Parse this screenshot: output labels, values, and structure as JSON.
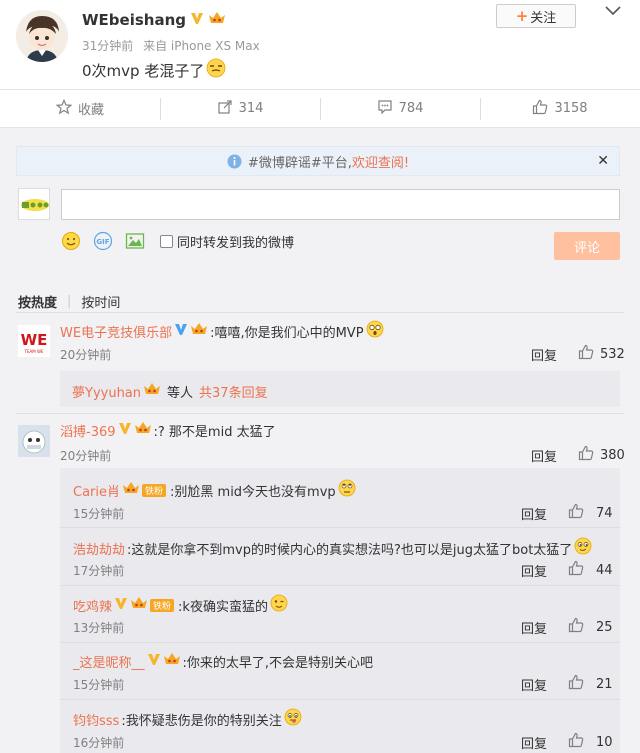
{
  "post": {
    "username": "WEbeishang",
    "time": "31分钟前",
    "source": "来自 iPhone XS Max",
    "text": "0次mvp 老混子了",
    "follow_label": "关注"
  },
  "actions": {
    "favorite": "收藏",
    "repost": "314",
    "comment": "784",
    "like": "3158"
  },
  "notice": {
    "prefix": "#微博辟谣#平台,",
    "link": "欢迎查阅!"
  },
  "composer": {
    "input_value": "",
    "repost_label": "同时转发到我的微博",
    "submit_label": "评论"
  },
  "sort": {
    "hot": "按热度",
    "time": "按时间"
  },
  "comments": [
    {
      "name": "WE电子竞技俱乐部",
      "text": ":嘻嘻,你是我们心中的MVP",
      "time": "20分钟前",
      "reply": "回复",
      "likes": "532",
      "summary": {
        "user": "夢Yyyuhan",
        "middle": "等人",
        "link": "共37条回复"
      }
    },
    {
      "name": "滔搏-369",
      "text": ":? 那不是mid 太猛了",
      "time": "20分钟前",
      "reply": "回复",
      "likes": "380",
      "replies": [
        {
          "name": "Carie肖",
          "fan_badge": "铁粉",
          "text": ":别尬黑 mid今天也没有mvp",
          "time": "15分钟前",
          "reply": "回复",
          "likes": "74"
        },
        {
          "name": "浩劫劫劫",
          "text": ":这就是你拿不到mvp的时候内心的真实想法吗?也可以是jug太猛了bot太猛了",
          "time": "17分钟前",
          "reply": "回复",
          "likes": "44"
        },
        {
          "name": "吃鸡辣",
          "fan_badge": "铁粉",
          "text": ":k夜确实蛮猛的",
          "time": "13分钟前",
          "reply": "回复",
          "likes": "25"
        },
        {
          "name": "_这是昵称__",
          "text": ":你来的太早了,不会是特别关心吧",
          "time": "15分钟前",
          "reply": "回复",
          "likes": "21"
        },
        {
          "name": "钧钧sss",
          "text": ":我怀疑悲伤是你的特别关注",
          "time": "16分钟前",
          "reply": "回复",
          "likes": "10"
        }
      ]
    }
  ],
  "colors": {
    "link": "#eb7350",
    "vip_gold": "#f7b52c",
    "verified_blue": "#4aa2f0",
    "submit_disabled": "#ffc09f",
    "panel_bg": "#f2f2f5"
  }
}
